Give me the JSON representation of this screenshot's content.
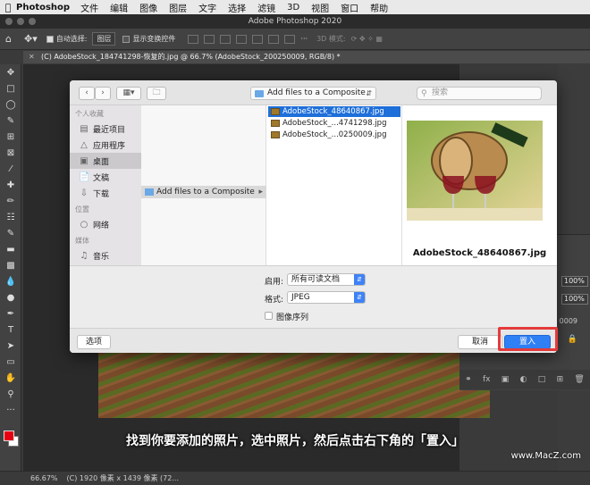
{
  "menubar": {
    "app_name": "Photoshop",
    "items": [
      "文件",
      "编辑",
      "图像",
      "图层",
      "文字",
      "选择",
      "滤镜",
      "3D",
      "视图",
      "窗口",
      "帮助"
    ]
  },
  "window_title": "Adobe Photoshop 2020",
  "options_bar": {
    "auto_select_label": "自动选择:",
    "auto_select_value": "图层",
    "transform_controls_label": "显示变换控件",
    "mode_3d_label": "3D 模式:"
  },
  "document_tab": "(C) AdobeStock_184741298-恢复的.jpg @ 66.7% (AdobeStock_200250009, RGB/8) *",
  "status_bar": {
    "zoom": "66.67%",
    "info": "(C) 1920 像素 x 1439 像素 (72..."
  },
  "layers_panel": {
    "opacity": "100%",
    "fill": "100%",
    "layer_partial": "0009"
  },
  "dialog": {
    "location": "Add files to a Composite",
    "search_placeholder": "搜索",
    "sidebar": {
      "favorites_header": "个人收藏",
      "favorites": [
        {
          "label": "最近项目",
          "icon": "recents-icon"
        },
        {
          "label": "应用程序",
          "icon": "applications-icon"
        },
        {
          "label": "桌面",
          "icon": "desktop-icon",
          "selected": true
        },
        {
          "label": "文稿",
          "icon": "documents-icon"
        },
        {
          "label": "下载",
          "icon": "downloads-icon"
        }
      ],
      "locations_header": "位置",
      "locations": [
        {
          "label": "网络",
          "icon": "network-icon"
        }
      ],
      "media_header": "媒体",
      "media": [
        {
          "label": "音乐",
          "icon": "music-icon"
        }
      ]
    },
    "column1_item": "Add files to a Composite",
    "files": [
      {
        "name": "AdobeStock_48640867.jpg",
        "selected": true
      },
      {
        "name": "AdobeStock_...4741298.jpg",
        "selected": false
      },
      {
        "name": "AdobeStock_...0250009.jpg",
        "selected": false
      }
    ],
    "preview_name": "AdobeStock_48640867.jpg",
    "options": {
      "enable_label": "启用:",
      "enable_value": "所有可读文档",
      "format_label": "格式:",
      "format_value": "JPEG",
      "image_sequence_label": "图像序列"
    },
    "buttons": {
      "options": "选项",
      "cancel": "取消",
      "place": "置入"
    }
  },
  "caption": "找到你要添加的照片，选中照片，然后点击右下角的「置入」",
  "watermark": "www.MacZ.com",
  "colors": {
    "foreground": "#e60012",
    "accent": "#2f7ff5",
    "highlight": "#e43b3b"
  }
}
